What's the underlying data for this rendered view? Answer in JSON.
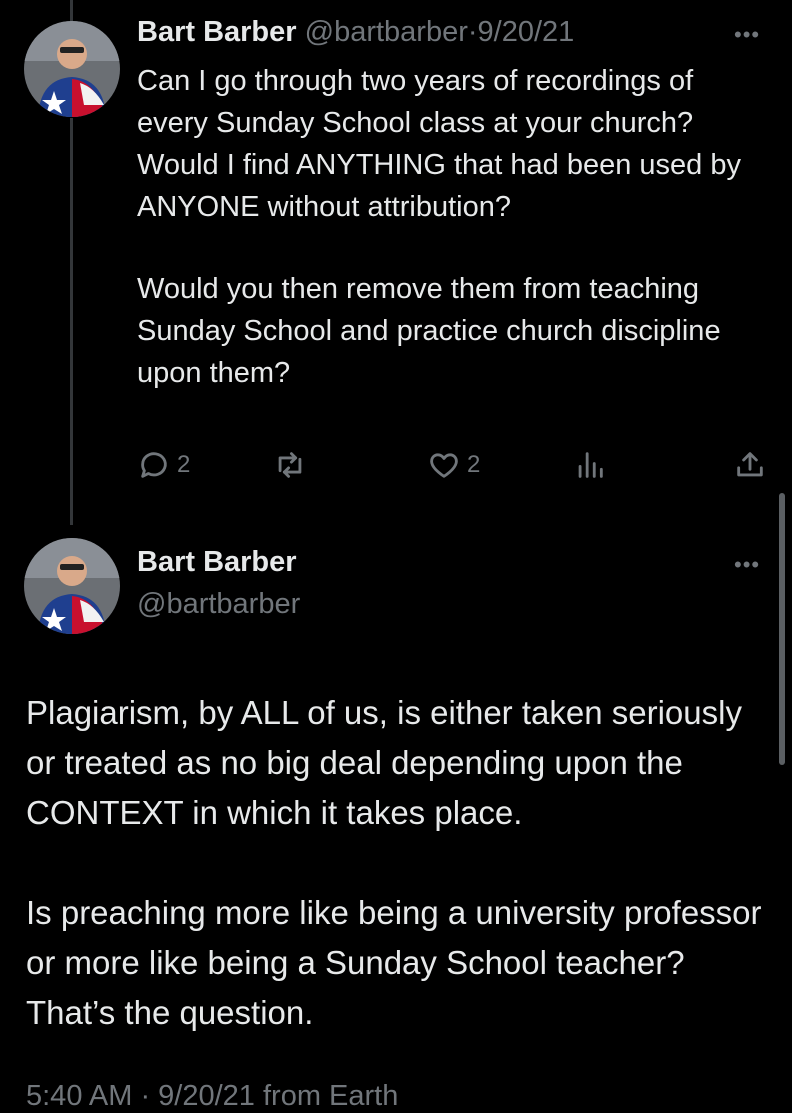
{
  "reply_tweet": {
    "author_name": "Bart Barber",
    "author_handle": "@bartbarber",
    "separator": "·",
    "date": "9/20/21",
    "more_label": "•••",
    "paragraphs": [
      "Can I go through two years of recordings of every Sunday School class at your church? Would I find ANYTHING that had been used by ANYONE without attribution?",
      "Would you then remove them from teaching Sunday School and practice church discipline upon them?"
    ],
    "actions": {
      "reply_count": "2",
      "retweet_count": "",
      "like_count": "2",
      "views_count": ""
    }
  },
  "main_tweet": {
    "author_name": "Bart Barber",
    "author_handle": "@bartbarber",
    "more_label": "•••",
    "paragraphs": [
      "Plagiarism, by ALL of us, is either taken seriously or treated as no big deal depending upon the CONTEXT in which it takes place.",
      "Is preaching more like being a university professor or more like being a Sunday School teacher? That’s the question."
    ],
    "footer_partial": "5:40 AM · 9/20/21 from Earth"
  },
  "colors": {
    "background": "#000000",
    "text": "#e7e9ea",
    "muted": "#71767b",
    "thread_line": "#333639",
    "flag_red": "#c8102e",
    "flag_blue": "#1f3f8f"
  },
  "icons": {
    "reply": "speech-bubble-icon",
    "retweet": "retweet-arrows-icon",
    "like": "heart-icon",
    "views": "bar-chart-icon",
    "share": "share-upload-icon",
    "more": "ellipsis-icon"
  }
}
